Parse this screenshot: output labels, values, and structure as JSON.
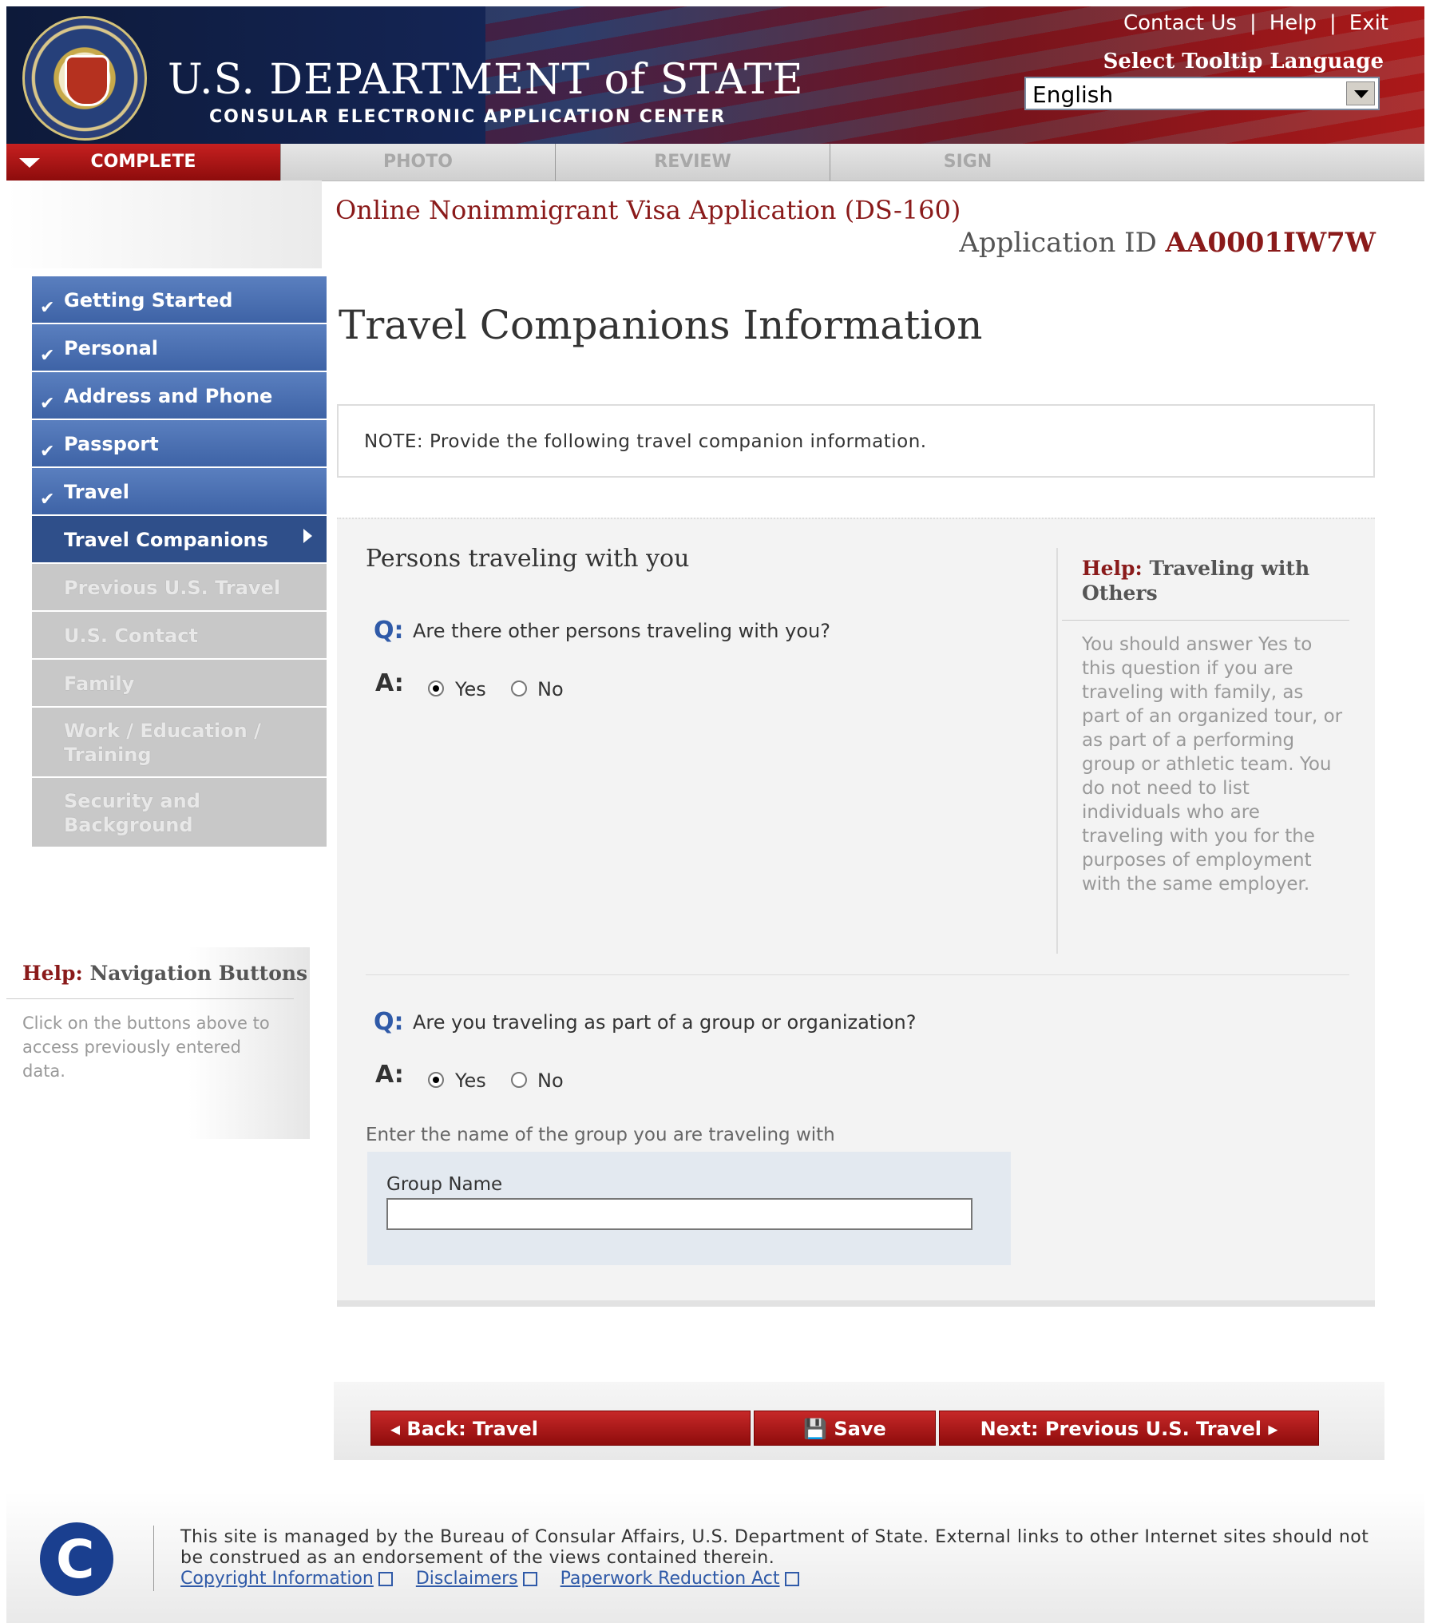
{
  "header": {
    "title": "U.S. DEPARTMENT of STATE",
    "subtitle": "CONSULAR ELECTRONIC APPLICATION CENTER",
    "links": [
      "Contact Us",
      "Help",
      "Exit"
    ],
    "tooltip_language_label": "Select Tooltip Language",
    "tooltip_language_value": "English"
  },
  "steps": [
    "COMPLETE",
    "PHOTO",
    "REVIEW",
    "SIGN"
  ],
  "form_title": "Online Nonimmigrant Visa Application (DS-160)",
  "application_id_label": "Application ID",
  "application_id": "AA0001IW7W",
  "sidebar": {
    "items": [
      {
        "label": "Getting Started"
      },
      {
        "label": "Personal"
      },
      {
        "label": "Address and Phone"
      },
      {
        "label": "Passport"
      },
      {
        "label": "Travel"
      },
      {
        "label": "Travel Companions"
      },
      {
        "label": "Previous U.S. Travel"
      },
      {
        "label": "U.S. Contact"
      },
      {
        "label": "Family"
      },
      {
        "label": "Work / Education / Training"
      },
      {
        "label": "Security and Background"
      }
    ],
    "help_title_prefix": "Help:",
    "help_title": "Navigation Buttons",
    "help_text": "Click on the buttons above to access previously entered data."
  },
  "page": {
    "title": "Travel Companions Information",
    "note": "NOTE: Provide the following travel companion information.",
    "section_title": "Persons traveling with you",
    "q_label": "Q:",
    "a_label": "A:",
    "q1": "Are there other persons traveling with you?",
    "q2": "Are you traveling as part of a group or organization?",
    "yes": "Yes",
    "no": "No",
    "group_hint": "Enter the name of the group you are traveling with",
    "group_name_label": "Group Name",
    "group_name_value": ""
  },
  "help_side": {
    "prefix": "Help:",
    "title": "Traveling with Others",
    "text": "You should answer Yes to this question if you are traveling with family, as part of an organized tour, or as part of a performing group or athletic team. You do not need to list individuals who are traveling with you for the purposes of employment with the same employer."
  },
  "buttons": {
    "back": "Back: Travel",
    "save": "Save",
    "next": "Next: Previous U.S. Travel"
  },
  "footer": {
    "text": "This site is managed by the Bureau of Consular Affairs, U.S. Department of State. External links to other Internet sites should not be construed as an endorsement of the views contained therein.",
    "links": [
      "Copyright Information",
      "Disclaimers",
      "Paperwork Reduction Act"
    ]
  },
  "colors": {
    "accent_red": "#8a1a1a",
    "nav_blue": "#4a6fb0",
    "q_blue": "#2f5aa8"
  }
}
